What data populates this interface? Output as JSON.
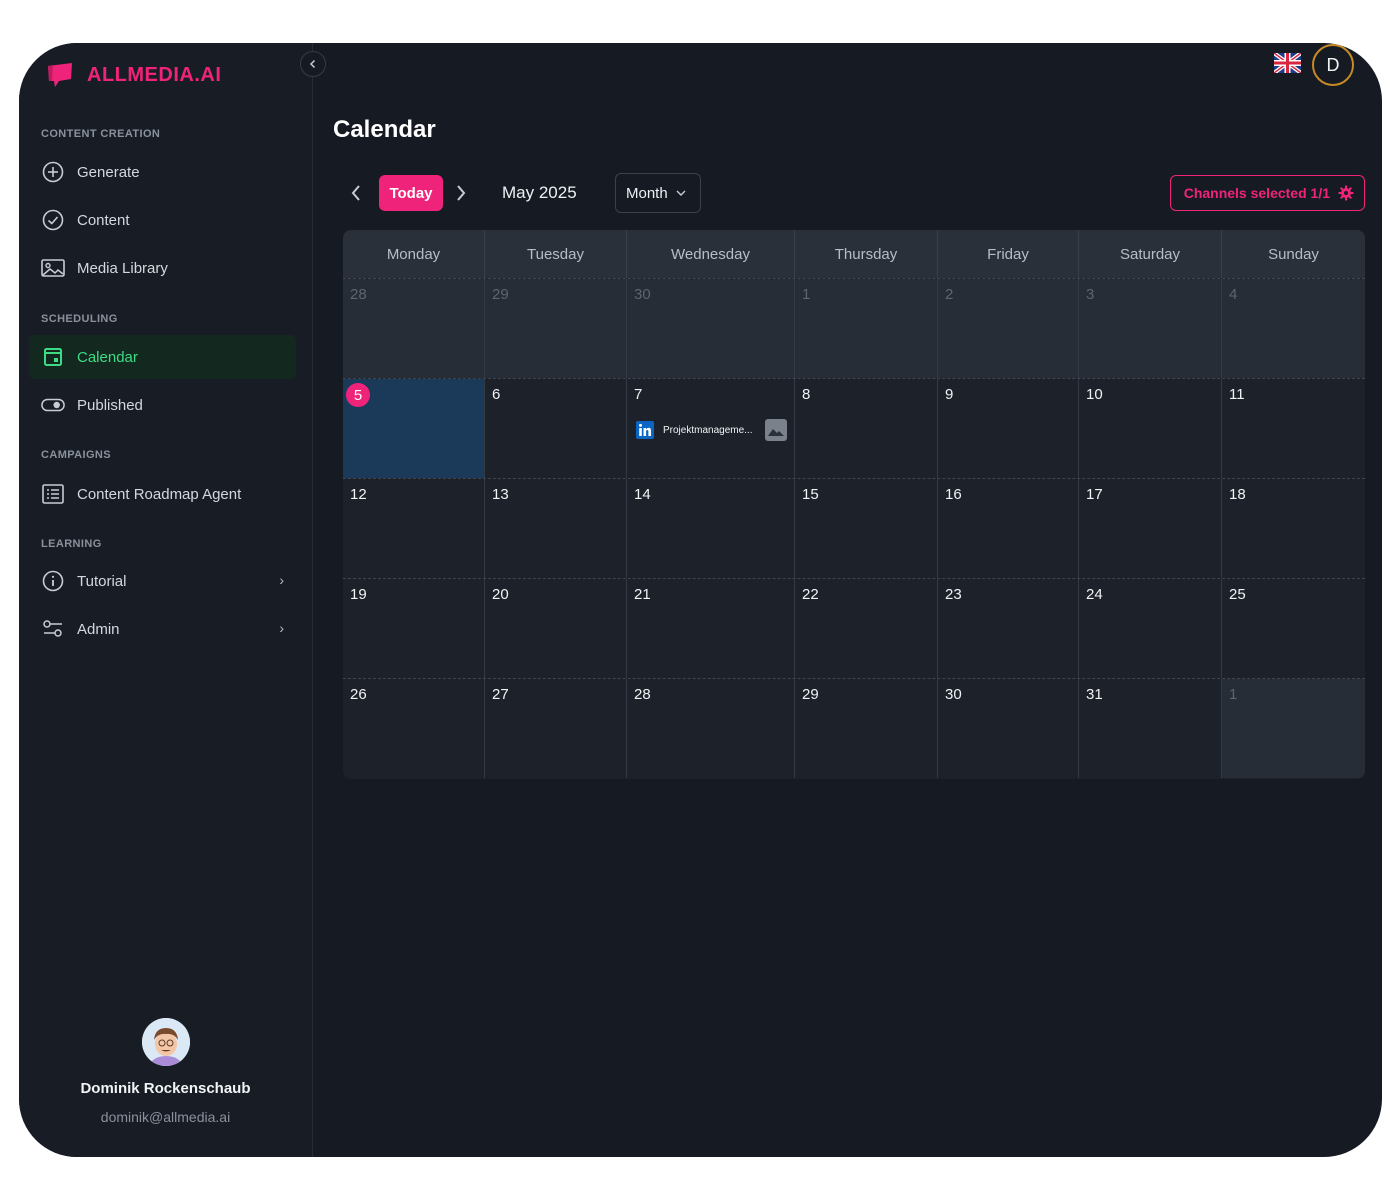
{
  "brand": {
    "name": "ALLMEDIA.AI",
    "color": "#f0237a"
  },
  "sidebar": {
    "sections": [
      {
        "label": "CONTENT CREATION"
      },
      {
        "label": "SCHEDULING"
      },
      {
        "label": "CAMPAIGNS"
      },
      {
        "label": "LEARNING"
      }
    ],
    "items": [
      {
        "label": "Generate",
        "icon": "plus-circle-icon"
      },
      {
        "label": "Content",
        "icon": "check-circle-icon"
      },
      {
        "label": "Media Library",
        "icon": "image-icon"
      },
      {
        "label": "Calendar",
        "icon": "calendar-icon",
        "active": true
      },
      {
        "label": "Published",
        "icon": "toggle-icon"
      },
      {
        "label": "Content Roadmap Agent",
        "icon": "list-icon"
      },
      {
        "label": "Tutorial",
        "icon": "info-icon"
      },
      {
        "label": "Admin",
        "icon": "sliders-icon"
      }
    ],
    "user": {
      "name": "Dominik Rockenschaub",
      "email": "dominik@allmedia.ai"
    }
  },
  "topbar": {
    "language_icon": "uk-flag-icon",
    "avatar_initial": "D"
  },
  "page": {
    "title": "Calendar"
  },
  "toolbar": {
    "today_label": "Today",
    "month_label": "May 2025",
    "view_label": "Month",
    "channels_label": "Channels selected 1/1"
  },
  "calendar": {
    "weekdays": [
      "Monday",
      "Tuesday",
      "Wednesday",
      "Thursday",
      "Friday",
      "Saturday",
      "Sunday"
    ],
    "weeks": [
      [
        "28",
        "29",
        "30",
        "1",
        "2",
        "3",
        "4"
      ],
      [
        "5",
        "6",
        "7",
        "8",
        "9",
        "10",
        "11"
      ],
      [
        "12",
        "13",
        "14",
        "15",
        "16",
        "17",
        "18"
      ],
      [
        "19",
        "20",
        "21",
        "22",
        "23",
        "24",
        "25"
      ],
      [
        "26",
        "27",
        "28",
        "29",
        "30",
        "31",
        "1"
      ]
    ],
    "today": "5",
    "event": {
      "channel": "linkedin-icon",
      "title": "Projektmanageme..."
    }
  }
}
